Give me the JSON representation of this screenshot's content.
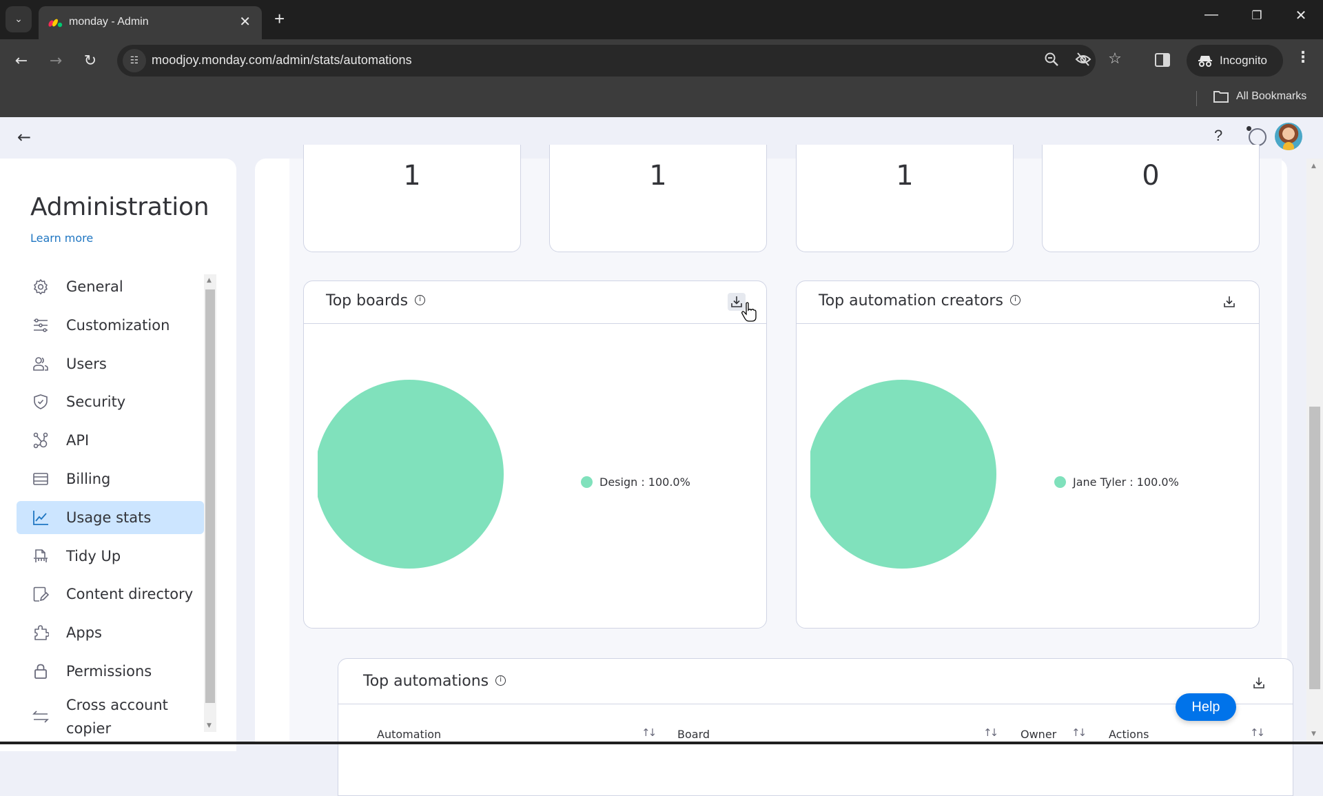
{
  "browser": {
    "tab_title": "monday - Admin",
    "url": "moodjoy.monday.com/admin/stats/automations",
    "incognito_label": "Incognito",
    "all_bookmarks_label": "All Bookmarks",
    "icons": [
      "tab-search-icon",
      "monday-favicon-icon",
      "close-icon",
      "plus-icon",
      "minimize-icon",
      "restore-icon",
      "close-window-icon",
      "back-icon",
      "forward-icon",
      "reload-icon",
      "site-info-icon",
      "zoom-out-icon",
      "eye-off-icon",
      "star-icon",
      "side-panel-icon",
      "incognito-icon",
      "more-vert-icon",
      "folder-icon"
    ]
  },
  "header": {
    "help_label": "?",
    "icons": [
      "back-arrow-icon",
      "help-icon",
      "ai-assistant-icon",
      "avatar"
    ]
  },
  "sidebar": {
    "title": "Administration",
    "learn_more": "Learn more",
    "items": [
      {
        "label": "General",
        "icon": "gear-icon",
        "active": false
      },
      {
        "label": "Customization",
        "icon": "sliders-icon",
        "active": false
      },
      {
        "label": "Users",
        "icon": "users-icon",
        "active": false
      },
      {
        "label": "Security",
        "icon": "shield-check-icon",
        "active": false
      },
      {
        "label": "API",
        "icon": "api-nodes-icon",
        "active": false
      },
      {
        "label": "Billing",
        "icon": "credit-card-icon",
        "active": false
      },
      {
        "label": "Usage stats",
        "icon": "line-chart-icon",
        "active": true
      },
      {
        "label": "Tidy Up",
        "icon": "shredder-icon",
        "active": false
      },
      {
        "label": "Content directory",
        "icon": "doc-edit-icon",
        "active": false
      },
      {
        "label": "Apps",
        "icon": "puzzle-icon",
        "active": false
      },
      {
        "label": "Permissions",
        "icon": "lock-icon",
        "active": false
      },
      {
        "label": "Cross account copier",
        "icon": "swap-arrows-icon",
        "active": false
      }
    ]
  },
  "stats": {
    "values": [
      "1",
      "1",
      "1",
      "0"
    ]
  },
  "top_boards": {
    "title": "Top boards",
    "info": "i"
  },
  "top_creators": {
    "title": "Top automation creators",
    "info": "i"
  },
  "top_automations": {
    "title": "Top automations",
    "info": "i",
    "columns": [
      "Automation",
      "Board",
      "Owner",
      "Actions"
    ],
    "sort_glyph": "↑↓"
  },
  "help_button": "Help",
  "colors": {
    "accent": "#0073ea",
    "active_nav_bg": "#cce5ff",
    "pie": "#80e1bc",
    "text": "#323338"
  },
  "chart_data": [
    {
      "type": "pie",
      "title": "Top boards",
      "categories": [
        "Design"
      ],
      "values": [
        100.0
      ],
      "legend": [
        {
          "label": "Design : 100.0%",
          "color": "#80e1bc"
        }
      ],
      "legend_placement": "right"
    },
    {
      "type": "pie",
      "title": "Top automation creators",
      "categories": [
        "Jane Tyler"
      ],
      "values": [
        100.0
      ],
      "legend": [
        {
          "label": "Jane Tyler : 100.0%",
          "color": "#80e1bc"
        }
      ],
      "legend_placement": "right"
    }
  ]
}
